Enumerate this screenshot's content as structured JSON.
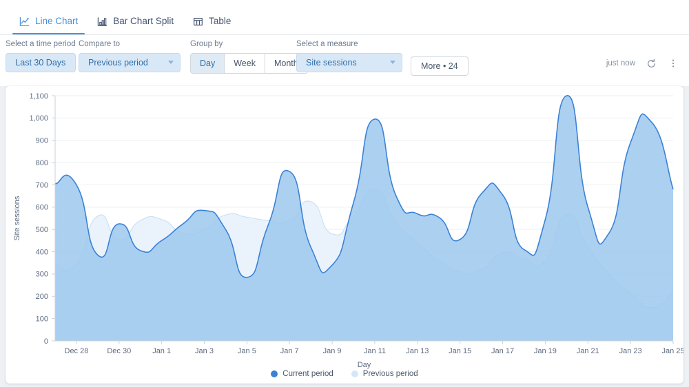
{
  "tabs": [
    {
      "label": "Line Chart",
      "icon": "line-chart-icon",
      "active": true
    },
    {
      "label": "Bar Chart Split",
      "icon": "bar-chart-icon",
      "active": false
    },
    {
      "label": "Table",
      "icon": "table-icon",
      "active": false
    }
  ],
  "controls": {
    "time_period": {
      "label": "Select a time period",
      "value": "Last 30 Days"
    },
    "compare_to": {
      "label": "Compare to",
      "value": "Previous period"
    },
    "group_by": {
      "label": "Group by",
      "options": [
        "Day",
        "Week",
        "Month"
      ],
      "selected": "Day"
    },
    "measure": {
      "label": "Select a measure",
      "value": "Site sessions"
    },
    "more": {
      "label": "More • 24"
    }
  },
  "status": {
    "refreshed_text": "just now",
    "refresh_icon": "refresh-icon",
    "menu_icon": "kebab-menu-icon"
  },
  "legend": [
    {
      "label": "Current period",
      "color": "#3b82d6"
    },
    {
      "label": "Previous period",
      "color": "#d5e6f7"
    }
  ],
  "colors": {
    "accent": "#4a90d9",
    "current_line": "#3b82d6",
    "current_fill": "#9fc9ee",
    "previous_fill": "#eaf3fc",
    "grid": "#eceff3",
    "page_bg": "#eef1f4",
    "card_bg": "#ffffff"
  },
  "chart_data": {
    "type": "area",
    "title": "",
    "xlabel": "Day",
    "ylabel": "Site sessions",
    "ylim": [
      0,
      1100
    ],
    "ytick_step": 100,
    "yticks": [
      0,
      100,
      200,
      300,
      400,
      500,
      600,
      700,
      800,
      900,
      1000,
      1100
    ],
    "ytick_labels": [
      "0",
      "100",
      "200",
      "300",
      "400",
      "500",
      "600",
      "700",
      "800",
      "900",
      "1,000",
      "1,100"
    ],
    "grid": true,
    "legend_position": "bottom",
    "x": [
      "Dec 27",
      "Dec 28",
      "Dec 29",
      "Dec 30",
      "Dec 31",
      "Jan 1",
      "Jan 2",
      "Jan 3",
      "Jan 4",
      "Jan 5",
      "Jan 6",
      "Jan 7",
      "Jan 8",
      "Jan 9",
      "Jan 10",
      "Jan 11",
      "Jan 12",
      "Jan 13",
      "Jan 14",
      "Jan 15",
      "Jan 16",
      "Jan 17",
      "Jan 18",
      "Jan 19",
      "Jan 20",
      "Jan 21",
      "Jan 22",
      "Jan 23",
      "Jan 24",
      "Jan 25"
    ],
    "xtick_labels": [
      "Dec 28",
      "Dec 30",
      "Jan 1",
      "Jan 3",
      "Jan 5",
      "Jan 7",
      "Jan 9",
      "Jan 11",
      "Jan 13",
      "Jan 15",
      "Jan 17",
      "Jan 19",
      "Jan 21",
      "Jan 23",
      "Jan 25"
    ],
    "xtick_indices": [
      1,
      3,
      5,
      7,
      9,
      11,
      13,
      15,
      17,
      19,
      21,
      23,
      25,
      27,
      29
    ],
    "series": [
      {
        "name": "Current period",
        "color": "#3b82d6",
        "fill": "#9fc9ee",
        "values": [
          705,
          700,
          385,
          525,
          405,
          450,
          525,
          585,
          500,
          285,
          520,
          760,
          420,
          340,
          620,
          995,
          650,
          570,
          555,
          455,
          660,
          655,
          410,
          545,
          1100,
          600,
          485,
          890,
          980,
          680
        ]
      },
      {
        "name": "Previous period",
        "color": "#c6dff5",
        "fill": "#eaf3fc",
        "values": [
          345,
          345,
          560,
          455,
          540,
          545,
          485,
          500,
          565,
          555,
          540,
          540,
          625,
          480,
          560,
          680,
          530,
          440,
          360,
          310,
          320,
          395,
          370,
          360,
          565,
          420,
          300,
          215,
          150,
          218
        ]
      }
    ]
  }
}
